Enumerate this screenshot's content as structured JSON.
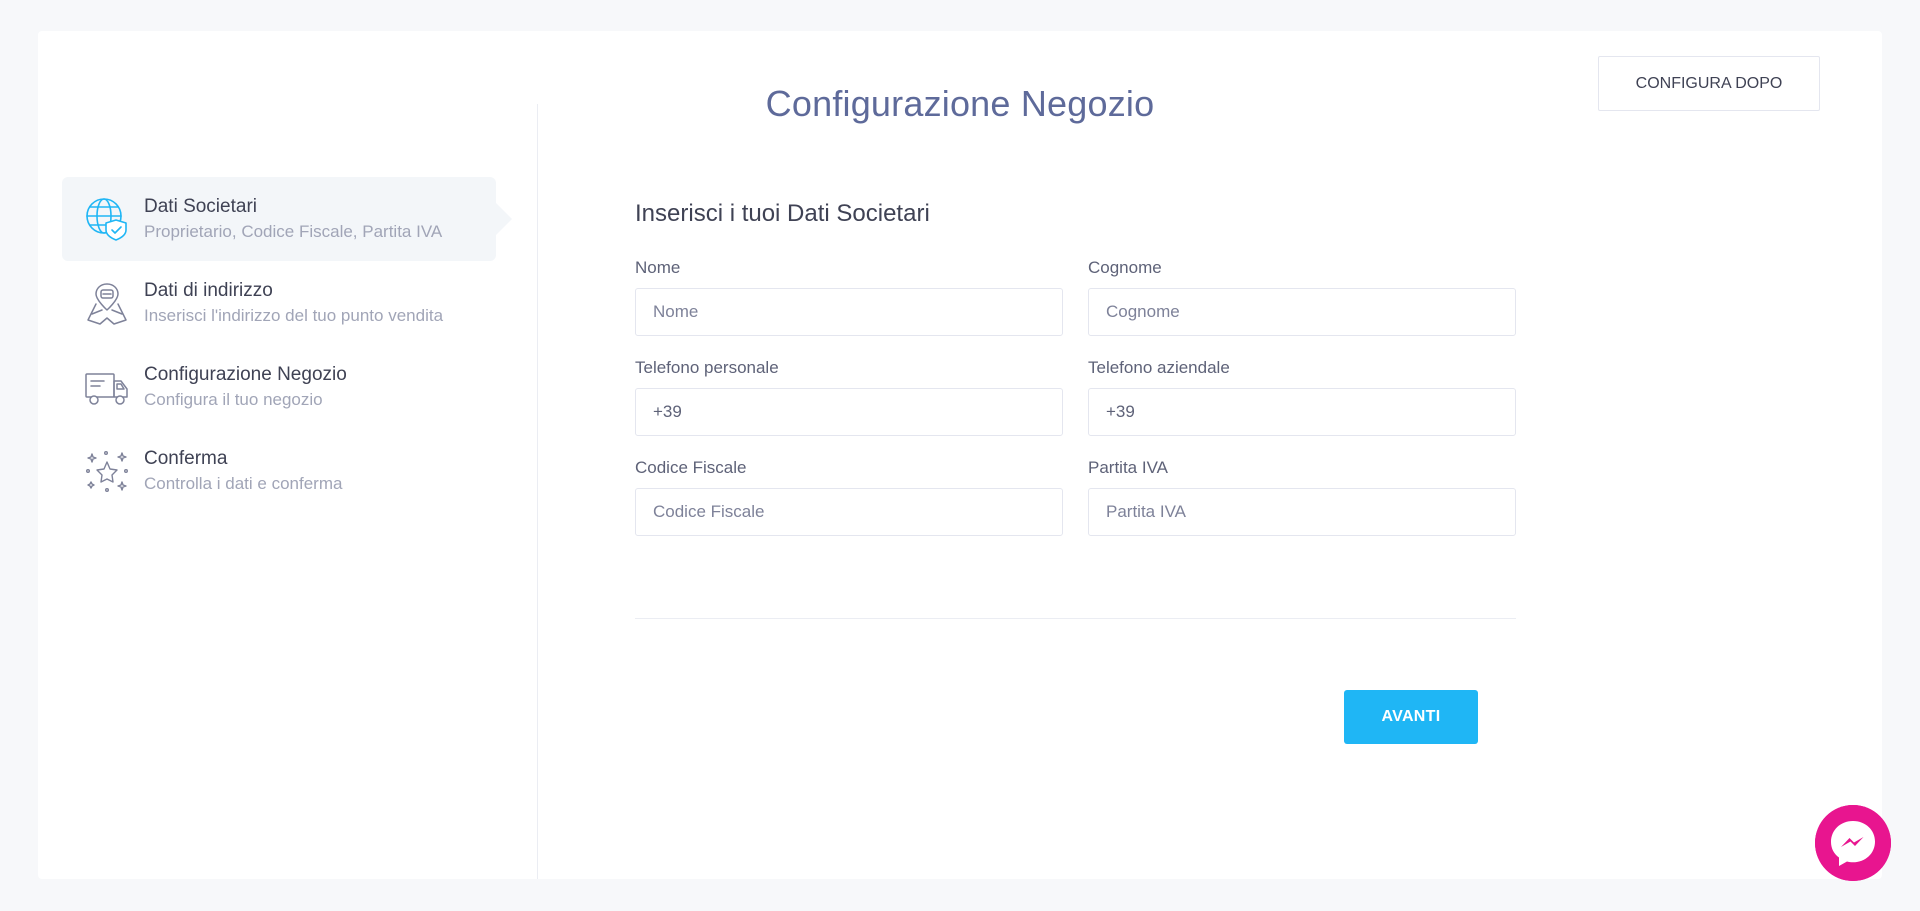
{
  "header": {
    "title": "Configurazione Negozio",
    "configure_later_label": "CONFIGURA DOPO"
  },
  "steps": [
    {
      "title": "Dati Societari",
      "desc": "Proprietario, Codice Fiscale, Partita IVA",
      "icon": "globe-shield-icon",
      "active": true
    },
    {
      "title": "Dati di indirizzo",
      "desc": "Inserisci l'indirizzo del tuo punto vendita",
      "icon": "map-icon",
      "active": false
    },
    {
      "title": "Configurazione Negozio",
      "desc": "Configura il tuo negozio",
      "icon": "delivery-truck-icon",
      "active": false
    },
    {
      "title": "Conferma",
      "desc": "Controlla i dati e conferma",
      "icon": "stars-icon",
      "active": false
    }
  ],
  "form": {
    "title": "Inserisci i tuoi Dati Societari",
    "fields": {
      "nome": {
        "label": "Nome",
        "placeholder": "Nome",
        "value": ""
      },
      "cognome": {
        "label": "Cognome",
        "placeholder": "Cognome",
        "value": ""
      },
      "telefono_personale": {
        "label": "Telefono personale",
        "placeholder": "",
        "value": "+39"
      },
      "telefono_aziendale": {
        "label": "Telefono aziendale",
        "placeholder": "",
        "value": "+39"
      },
      "codice_fiscale": {
        "label": "Codice Fiscale",
        "placeholder": "Codice Fiscale",
        "value": ""
      },
      "partita_iva": {
        "label": "Partita IVA",
        "placeholder": "Partita IVA",
        "value": ""
      }
    },
    "next_label": "AVANTI"
  },
  "colors": {
    "accent": "#1fb6f5",
    "title": "#5e6a9a",
    "messenger": "#e8158f",
    "active_step_bg": "#f3f6f9"
  },
  "chat_widget": {
    "icon": "messenger-icon"
  }
}
